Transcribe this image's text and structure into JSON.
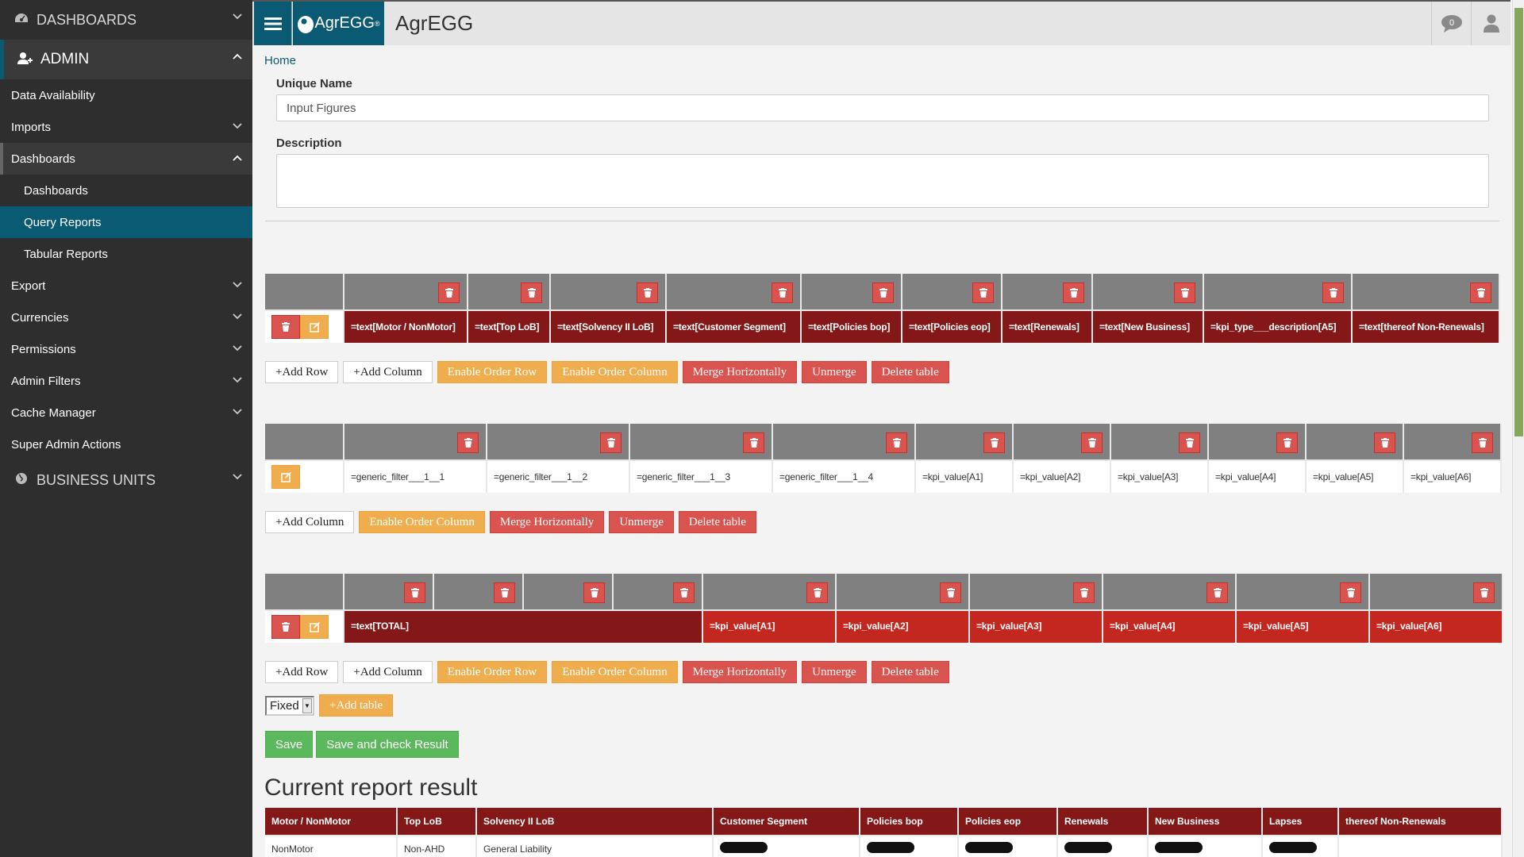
{
  "sidebar": {
    "sections": [
      {
        "label": "DASHBOARDS",
        "icon": "dashboard-icon",
        "expanded": false
      },
      {
        "label": "ADMIN",
        "icon": "user-plus-icon",
        "expanded": true
      },
      {
        "label": "BUSINESS UNITS",
        "icon": "globe-icon",
        "expanded": false
      }
    ],
    "admin_items": [
      {
        "label": "Data Availability",
        "has_chevron": false
      },
      {
        "label": "Imports",
        "has_chevron": true
      },
      {
        "label": "Dashboards",
        "has_chevron": true,
        "expanded": true
      },
      {
        "label": "Dashboards",
        "sub": true
      },
      {
        "label": "Query Reports",
        "sub": true,
        "active": true
      },
      {
        "label": "Tabular Reports",
        "sub": true
      },
      {
        "label": "Export",
        "has_chevron": true
      },
      {
        "label": "Currencies",
        "has_chevron": true
      },
      {
        "label": "Permissions",
        "has_chevron": true
      },
      {
        "label": "Admin Filters",
        "has_chevron": true
      },
      {
        "label": "Cache Manager",
        "has_chevron": true
      },
      {
        "label": "Super Admin Actions",
        "has_chevron": false
      }
    ]
  },
  "topbar": {
    "logo_text": "AgrEGG",
    "logo_mark": "®",
    "title": "AgrEGG",
    "notifications_count": "0"
  },
  "breadcrumb": {
    "home": "Home"
  },
  "form": {
    "unique_name_label": "Unique Name",
    "unique_name_value": "Input Figures",
    "description_label": "Description",
    "description_value": ""
  },
  "tables": [
    {
      "style": "header",
      "cells": [
        "=text[Motor / NonMotor]",
        "=text[Top LoB]",
        "=text[Solvency II LoB]",
        "=text[Customer Segment]",
        "=text[Policies bop]",
        "=text[Policies eop]",
        "=text[Renewals]",
        "=text[New Business]",
        "=kpi_type___description[A5]",
        "=text[thereof Non-Renewals]"
      ],
      "buttons": [
        "+Add Row",
        "+Add Column",
        "Enable Order Row",
        "Enable Order Column",
        "Merge Horizontally",
        "Unmerge",
        "Delete table"
      ]
    },
    {
      "style": "data",
      "cells": [
        "=generic_filter___1__1",
        "=generic_filter___1__2",
        "=generic_filter___1__3",
        "=generic_filter___1__4",
        "=kpi_value[A1]",
        "=kpi_value[A2]",
        "=kpi_value[A3]",
        "=kpi_value[A4]",
        "=kpi_value[A5]",
        "=kpi_value[A6]"
      ],
      "buttons": [
        "+Add Column",
        "Enable Order Column",
        "Merge Horizontally",
        "Unmerge",
        "Delete table"
      ]
    },
    {
      "style": "total",
      "cells": [
        "=text[TOTAL]",
        "=kpi_value[A1]",
        "=kpi_value[A2]",
        "=kpi_value[A3]",
        "=kpi_value[A4]",
        "=kpi_value[A5]",
        "=kpi_value[A6]"
      ],
      "buttons": [
        "+Add Row",
        "+Add Column",
        "Enable Order Row",
        "Enable Order Column",
        "Merge Horizontally",
        "Unmerge",
        "Delete table"
      ]
    }
  ],
  "table_type_select": {
    "value": "Fixed"
  },
  "add_table_label": "+Add table",
  "save_label": "Save",
  "save_check_label": "Save and check Result",
  "result": {
    "title": "Current report result",
    "columns": [
      "Motor / NonMotor",
      "Top LoB",
      "Solvency II LoB",
      "Customer Segment",
      "Policies bop",
      "Policies eop",
      "Renewals",
      "New Business",
      "Lapses",
      "thereof Non-Renewals"
    ],
    "rows": [
      [
        "NonMotor",
        "Non-AHD",
        "General Liability",
        "[redacted]",
        "[redacted]",
        "[redacted]",
        "[redacted]",
        "[redacted]",
        "[redacted]",
        ""
      ]
    ]
  },
  "colors": {
    "brand": "#0b5a73",
    "header_cell": "#841717",
    "total_cell": "#c4271f",
    "danger": "#d9534f",
    "warning": "#f0ad4e",
    "success": "#5cb85c",
    "scroll_thumb": "#86a65a"
  }
}
